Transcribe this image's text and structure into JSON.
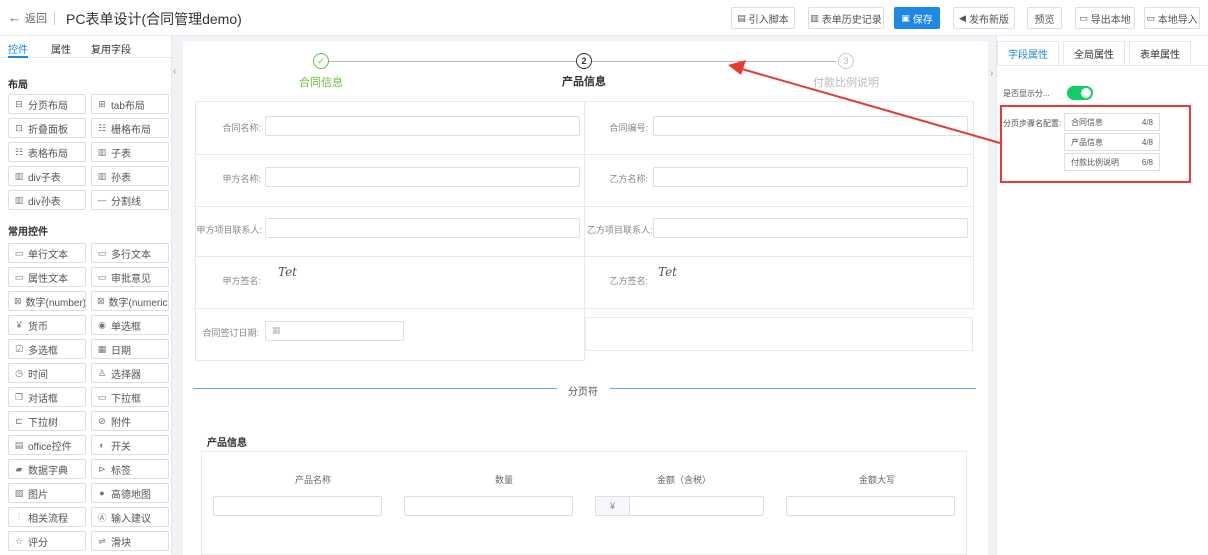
{
  "header": {
    "back_label": "返回",
    "title": "PC表单设计(合同管理demo)",
    "buttons": [
      {
        "label": "引入脚本",
        "icon": "script-icon"
      },
      {
        "label": "表单历史记录",
        "icon": "history-icon"
      },
      {
        "label": "保存",
        "icon": "save-icon"
      },
      {
        "label": "发布新版",
        "icon": "publish-icon"
      },
      {
        "label": "预览",
        "icon": ""
      },
      {
        "label": "导出本地",
        "icon": "export-icon"
      },
      {
        "label": "本地导入",
        "icon": "import-icon"
      }
    ],
    "primary_color": "#1e88e5"
  },
  "left_panel": {
    "tabs": [
      "控件",
      "属性",
      "复用字段"
    ],
    "sections": [
      {
        "title": "布局",
        "items": [
          "分页布局",
          "tab布局",
          "折叠面板",
          "栅格布局",
          "表格布局",
          "子表",
          "div子表",
          "孙表",
          "div孙表",
          "分割线"
        ]
      },
      {
        "title": "常用控件",
        "items": [
          "单行文本",
          "多行文本",
          "属性文本",
          "审批意见",
          "数字(number)",
          "数字(numeric)",
          "货币",
          "单选框",
          "多选框",
          "日期",
          "时间",
          "选择器",
          "对话框",
          "下拉框",
          "下拉树",
          "附件",
          "office控件",
          "开关",
          "数据字典",
          "标签",
          "图片",
          "高德地图",
          "相关流程",
          "输入建议",
          "评分",
          "滑块"
        ]
      }
    ]
  },
  "canvas": {
    "steps": [
      {
        "number": "1",
        "label": "合同信息",
        "state": "done"
      },
      {
        "number": "2",
        "label": "产品信息",
        "state": "active"
      },
      {
        "number": "3",
        "label": "付款比例说明",
        "state": "pending"
      }
    ],
    "fields": {
      "contract_name": "合同名称:",
      "contract_no": "合同编号:",
      "party_a_name": "甲方名称:",
      "party_b_name": "乙方名称:",
      "party_a_contact": "甲方项目联系人:",
      "party_b_contact": "乙方项目联系人:",
      "party_a_sign": "甲方签名:",
      "party_b_sign": "乙方签名:",
      "sign_date": "合同签订日期:"
    },
    "signature_text": "Tet",
    "page_divider": "分页符",
    "product_section": {
      "title": "产品信息",
      "columns": [
        "产品名称",
        "数量",
        "金额（含税）",
        "金额大写"
      ],
      "currency_symbol": "¥"
    }
  },
  "right_panel": {
    "tabs": [
      "字段属性",
      "全局属性",
      "表单属性"
    ],
    "show_step_label": "是否显示分...",
    "toggle_on": true,
    "step_config_label": "分页步骤名配置:",
    "step_config": [
      {
        "name": "合同信息",
        "count": "4/8"
      },
      {
        "name": "产品信息",
        "count": "4/8"
      },
      {
        "name": "付款比例说明",
        "count": "6/8"
      }
    ]
  }
}
